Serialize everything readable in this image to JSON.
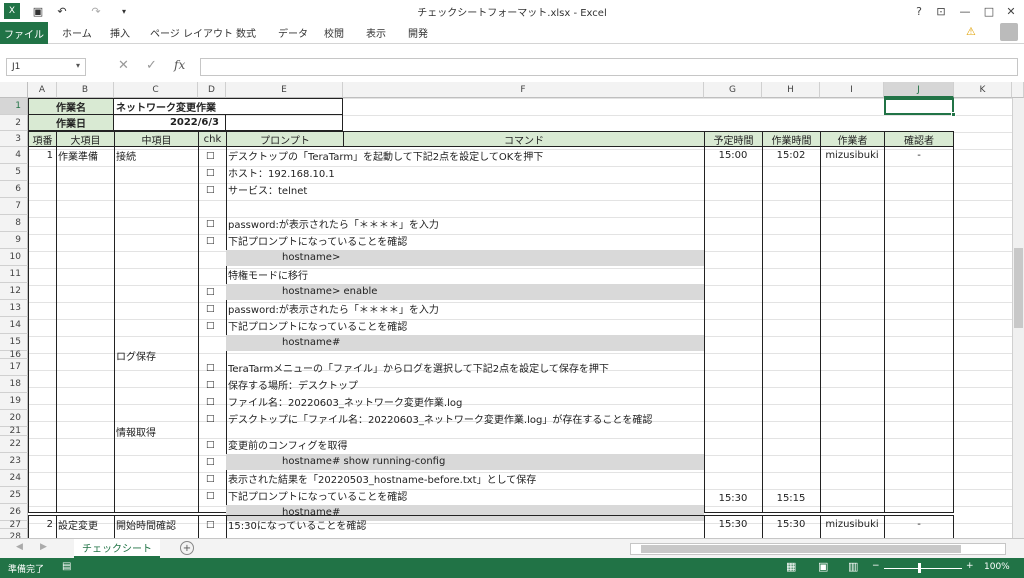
{
  "title_bar": {
    "title": "チェックシートフォーマット.xlsx - Excel",
    "help": "?",
    "minimize": "—",
    "restore": "□",
    "close": "✕"
  },
  "ribbon": {
    "file_tab": "ファイル",
    "tabs": [
      "ホーム",
      "挿入",
      "ページ レイアウト",
      "数式",
      "データ",
      "校閲",
      "表示",
      "開発"
    ]
  },
  "formula_bar": {
    "name_box": "J1",
    "fx": "fx",
    "value": ""
  },
  "columns": [
    "A",
    "B",
    "C",
    "D",
    "E",
    "F",
    "G",
    "H",
    "I",
    "J",
    "K"
  ],
  "rows": [
    "1",
    "2",
    "3",
    "4",
    "5",
    "6",
    "7",
    "8",
    "9",
    "10",
    "11",
    "12",
    "13",
    "14",
    "15",
    "16",
    "17",
    "18",
    "19",
    "20",
    "21",
    "22",
    "23",
    "24",
    "25",
    "26",
    "27",
    "28"
  ],
  "sheet": {
    "work_name_label": "作業名",
    "work_name_value": "ネットワーク変更作業",
    "work_date_label": "作業日",
    "work_date_value": "2022/6/3",
    "headers": {
      "item_no": "項番",
      "major": "大項目",
      "middle": "中項目",
      "chk": "chk",
      "prompt": "プロンプト",
      "command": "コマンド",
      "planned_time": "予定時間",
      "work_time": "作業時間",
      "worker": "作業者",
      "checker": "確認者"
    },
    "section1": {
      "no": "1",
      "major": "作業準備",
      "sub1": "接続",
      "sub2": "ログ保存",
      "sub3": "情報取得",
      "planned_start": "15:00",
      "work_start": "15:02",
      "worker": "mizusibuki",
      "checker": "-",
      "planned_end": "15:30",
      "work_end": "15:15"
    },
    "lines": [
      {
        "row": "4",
        "chk": "□",
        "text": "デスクトップの「TeraTarm」を起動して下記2点を設定してOKを押下",
        "prompt": false
      },
      {
        "row": "5",
        "chk": "□",
        "text": "ホスト：192.168.10.1",
        "prompt": false
      },
      {
        "row": "6",
        "chk": "□",
        "text": "サービス：telnet",
        "prompt": false
      },
      {
        "row": "8",
        "chk": "□",
        "text": "password:が表示されたら「＊＊＊＊」を入力",
        "prompt": false
      },
      {
        "row": "9",
        "chk": "□",
        "text": "下記プロンプトになっていることを確認",
        "prompt": false
      },
      {
        "row": "10",
        "chk": "",
        "text": "hostname>",
        "prompt": true
      },
      {
        "row": "11",
        "chk": "",
        "text": "特権モードに移行",
        "prompt": false
      },
      {
        "row": "12",
        "chk": "□",
        "text": "hostname> enable",
        "prompt": true
      },
      {
        "row": "13",
        "chk": "□",
        "text": "password:が表示されたら「＊＊＊＊」を入力",
        "prompt": false
      },
      {
        "row": "14",
        "chk": "□",
        "text": "下記プロンプトになっていることを確認",
        "prompt": false
      },
      {
        "row": "15",
        "chk": "",
        "text": "hostname#",
        "prompt": true
      },
      {
        "row": "17",
        "chk": "□",
        "text": "TeraTarmメニューの「ファイル」からログを選択して下記2点を設定して保存を押下",
        "prompt": false
      },
      {
        "row": "18",
        "chk": "□",
        "text": "保存する場所：デスクトップ",
        "prompt": false
      },
      {
        "row": "19",
        "chk": "□",
        "text": "ファイル名：20220603_ネットワーク変更作業.log",
        "prompt": false
      },
      {
        "row": "20",
        "chk": "□",
        "text": "デスクトップに「ファイル名：20220603_ネットワーク変更作業.log」が存在することを確認",
        "prompt": false
      },
      {
        "row": "22",
        "chk": "□",
        "text": "変更前のコンフィグを取得",
        "prompt": false
      },
      {
        "row": "23",
        "chk": "□",
        "text": "hostname# show running-config",
        "prompt": true
      },
      {
        "row": "24",
        "chk": "□",
        "text": "表示された結果を「20220503_hostname-before.txt」として保存",
        "prompt": false
      },
      {
        "row": "25",
        "chk": "□",
        "text": "下記プロンプトになっていることを確認",
        "prompt": false
      },
      {
        "row": "26",
        "chk": "",
        "text": "hostname#",
        "prompt": true
      }
    ],
    "section2": {
      "no": "2",
      "major": "設定変更",
      "middle": "開始時間確認",
      "chk": "□",
      "text": "15:30になっていることを確認",
      "planned": "15:30",
      "work": "15:30",
      "worker": "mizusibuki",
      "checker": "-"
    }
  },
  "sheet_tabs": {
    "active": "チェックシート",
    "add": "+"
  },
  "status_bar": {
    "ready": "準備完了",
    "zoom": "100%"
  }
}
